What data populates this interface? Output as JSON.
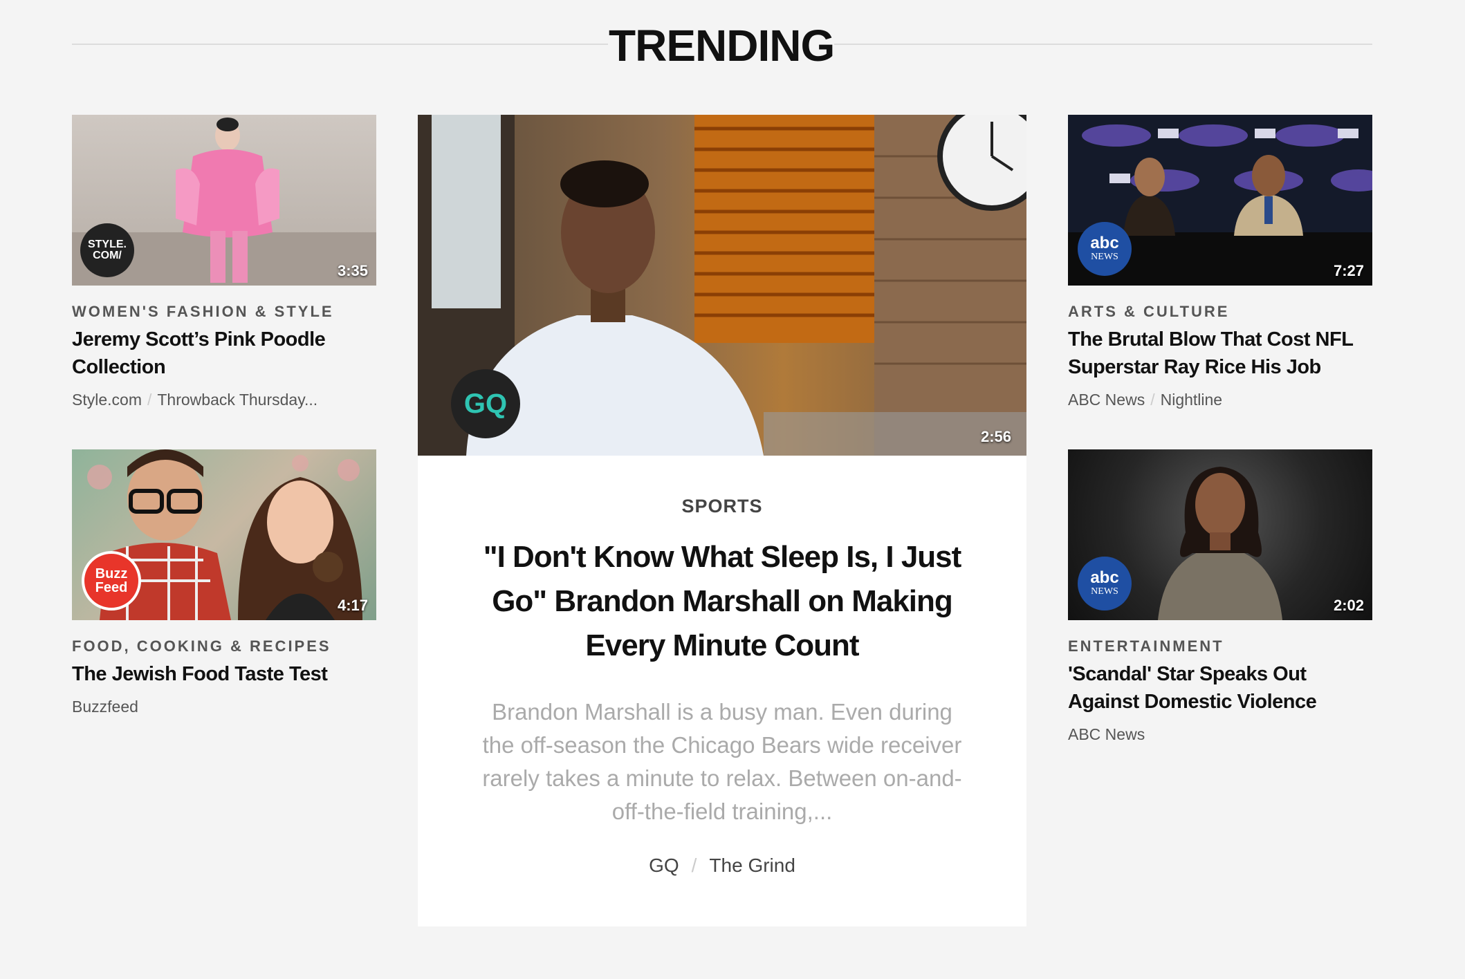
{
  "section_title": "TRENDING",
  "feature": {
    "category": "SPORTS",
    "title": "\"I Don't Know What Sleep Is, I Just Go\" Brandon Marshall on Making Every Minute Count",
    "description": "Brandon Marshall is a busy man. Even during the off-season the Chicago Bears wide receiver rarely takes a minute to relax. Between on-and-off-the-field training,...",
    "source": "GQ",
    "series": "The Grind",
    "duration": "2:56",
    "logo_text": "GQ"
  },
  "cards": [
    {
      "category": "WOMEN'S FASHION & STYLE",
      "title": "Jeremy Scott’s Pink Poodle Collection",
      "source": "Style.com",
      "series": "Throwback Thursday...",
      "duration": "3:35",
      "logo_text": "STYLE.\nCOM/"
    },
    {
      "category": "FOOD, COOKING & RECIPES",
      "title": "The Jewish Food Taste Test",
      "source": "Buzzfeed",
      "duration": "4:17",
      "logo_text": "Buzz\nFeed"
    },
    {
      "category": "ARTS & CULTURE",
      "title": "The Brutal Blow That Cost NFL Superstar Ray Rice His Job",
      "source": "ABC News",
      "series": "Nightline",
      "duration": "7:27",
      "logo_text": "abc",
      "logo_sub": "NEWS"
    },
    {
      "category": "ENTERTAINMENT",
      "title": "'Scandal' Star Speaks Out Against Domestic Violence",
      "source": "ABC News",
      "duration": "2:02",
      "logo_text": "abc",
      "logo_sub": "NEWS"
    }
  ]
}
